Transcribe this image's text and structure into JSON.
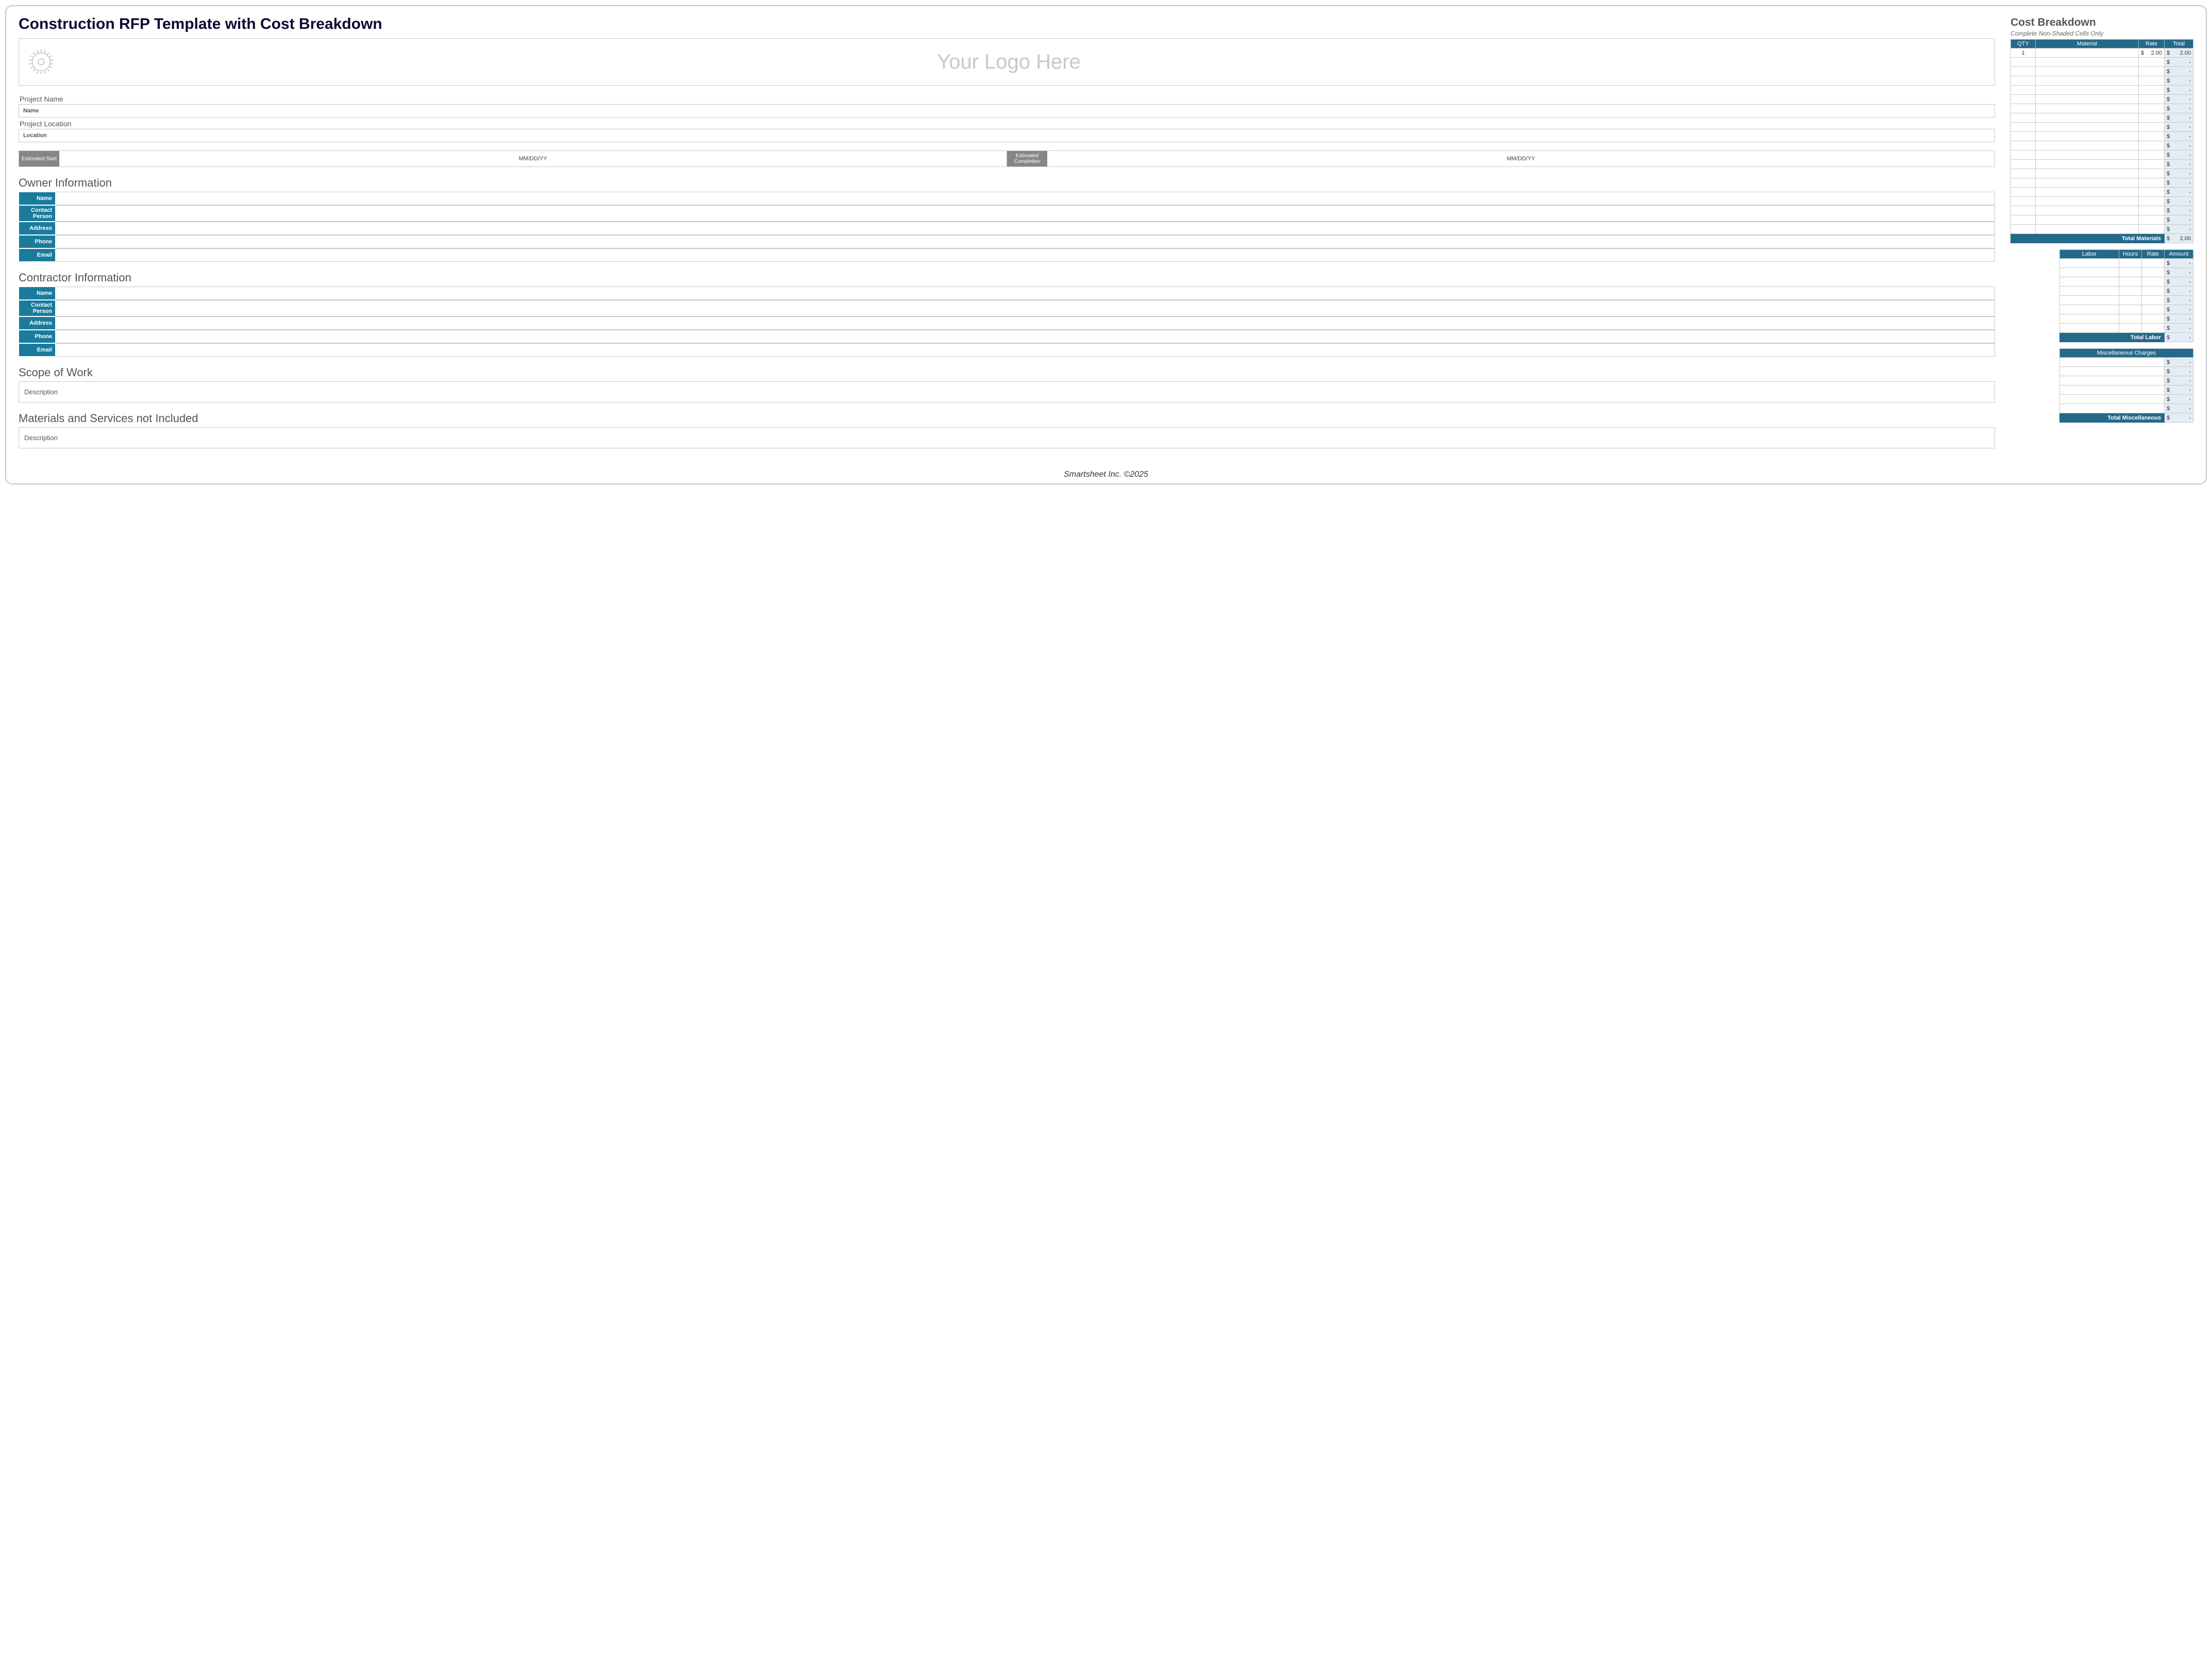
{
  "title": "Construction RFP Template with Cost Breakdown",
  "logo_placeholder": "Your Logo Here",
  "project": {
    "name_label": "Project Name",
    "name_placeholder": "Name",
    "location_label": "Project Location",
    "location_placeholder": "Location",
    "est_start_label": "Estimated Start",
    "est_start_value": "MM/DD/YY",
    "est_completion_label": "Estimated Completion",
    "est_completion_value": "MM/DD/YY"
  },
  "sections": {
    "owner_title": "Owner Information",
    "contractor_title": "Contractor Information",
    "scope_title": "Scope of Work",
    "materials_title": "Materials and Services not Included",
    "description_placeholder": "Description"
  },
  "labels": {
    "name": "Name",
    "contact": "Contact Person",
    "address": "Address",
    "phone": "Phone",
    "email": "Email"
  },
  "cost": {
    "title": "Cost Breakdown",
    "hint": "Complete Non-Shaded Cells Only",
    "materials": {
      "headers": {
        "qty": "QTY",
        "material": "Material",
        "rate": "Rate",
        "total": "Total"
      },
      "rows": [
        {
          "qty": "1",
          "material": "",
          "rate": "2.00",
          "total": "2.00"
        },
        {
          "qty": "",
          "material": "",
          "rate": "",
          "total": "-"
        },
        {
          "qty": "",
          "material": "",
          "rate": "",
          "total": "-"
        },
        {
          "qty": "",
          "material": "",
          "rate": "",
          "total": "-"
        },
        {
          "qty": "",
          "material": "",
          "rate": "",
          "total": "-"
        },
        {
          "qty": "",
          "material": "",
          "rate": "",
          "total": "-"
        },
        {
          "qty": "",
          "material": "",
          "rate": "",
          "total": "-"
        },
        {
          "qty": "",
          "material": "",
          "rate": "",
          "total": "-"
        },
        {
          "qty": "",
          "material": "",
          "rate": "",
          "total": "-"
        },
        {
          "qty": "",
          "material": "",
          "rate": "",
          "total": "-"
        },
        {
          "qty": "",
          "material": "",
          "rate": "",
          "total": "-"
        },
        {
          "qty": "",
          "material": "",
          "rate": "",
          "total": "-"
        },
        {
          "qty": "",
          "material": "",
          "rate": "",
          "total": "-"
        },
        {
          "qty": "",
          "material": "",
          "rate": "",
          "total": "-"
        },
        {
          "qty": "",
          "material": "",
          "rate": "",
          "total": "-"
        },
        {
          "qty": "",
          "material": "",
          "rate": "",
          "total": "-"
        },
        {
          "qty": "",
          "material": "",
          "rate": "",
          "total": "-"
        },
        {
          "qty": "",
          "material": "",
          "rate": "",
          "total": "-"
        },
        {
          "qty": "",
          "material": "",
          "rate": "",
          "total": "-"
        },
        {
          "qty": "",
          "material": "",
          "rate": "",
          "total": "-"
        }
      ],
      "total_label": "Total Materials",
      "total_value": "2.00"
    },
    "labor": {
      "headers": {
        "labor": "Labor",
        "hours": "Hours",
        "rate": "Rate",
        "amount": "Amount"
      },
      "rows": [
        {
          "labor": "",
          "hours": "",
          "rate": "",
          "amount": "-"
        },
        {
          "labor": "",
          "hours": "",
          "rate": "",
          "amount": "-"
        },
        {
          "labor": "",
          "hours": "",
          "rate": "",
          "amount": "-"
        },
        {
          "labor": "",
          "hours": "",
          "rate": "",
          "amount": "-"
        },
        {
          "labor": "",
          "hours": "",
          "rate": "",
          "amount": "-"
        },
        {
          "labor": "",
          "hours": "",
          "rate": "",
          "amount": "-"
        },
        {
          "labor": "",
          "hours": "",
          "rate": "",
          "amount": "-"
        },
        {
          "labor": "",
          "hours": "",
          "rate": "",
          "amount": "-"
        }
      ],
      "total_label": "Total Labor",
      "total_value": "-"
    },
    "misc": {
      "header": "Miscellaneous Charges",
      "rows": [
        {
          "desc": "",
          "amount": "-"
        },
        {
          "desc": "",
          "amount": "-"
        },
        {
          "desc": "",
          "amount": "-"
        },
        {
          "desc": "",
          "amount": "-"
        },
        {
          "desc": "",
          "amount": "-"
        },
        {
          "desc": "",
          "amount": "-"
        }
      ],
      "total_label": "Total Miscellaneous",
      "total_value": "-"
    }
  },
  "footer": "Smartsheet Inc. ©2025"
}
